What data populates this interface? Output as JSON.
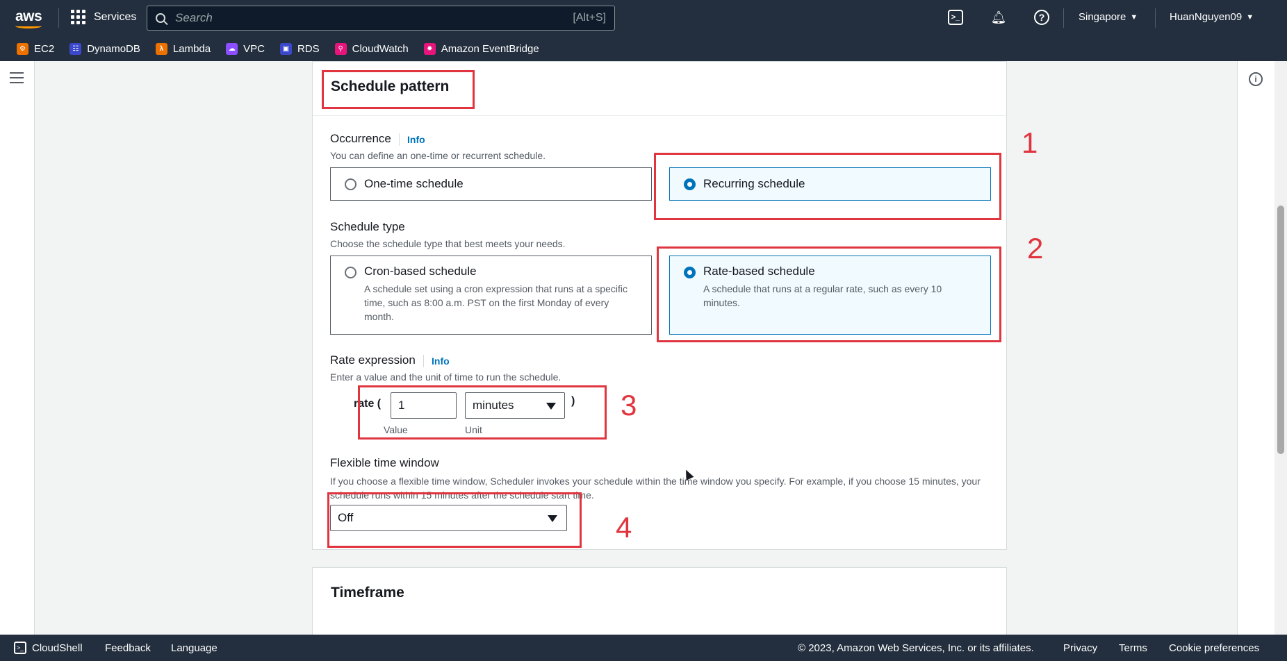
{
  "topnav": {
    "logo": "aws",
    "services_label": "Services",
    "search_placeholder": "Search",
    "search_shortcut": "[Alt+S]",
    "region": "Singapore",
    "user": "HuanNguyen09"
  },
  "favorites": [
    {
      "label": "EC2",
      "color": "#ed7100"
    },
    {
      "label": "DynamoDB",
      "color": "#3b48cc"
    },
    {
      "label": "Lambda",
      "color": "#ed7100"
    },
    {
      "label": "VPC",
      "color": "#8c4fff"
    },
    {
      "label": "RDS",
      "color": "#3b48cc"
    },
    {
      "label": "CloudWatch",
      "color": "#e7157b"
    },
    {
      "label": "Amazon EventBridge",
      "color": "#e7157b"
    }
  ],
  "schedule_pattern": {
    "title": "Schedule pattern",
    "occurrence": {
      "label": "Occurrence",
      "info": "Info",
      "description": "You can define an one-time or recurrent schedule.",
      "options": [
        {
          "label": "One-time schedule",
          "selected": false
        },
        {
          "label": "Recurring schedule",
          "selected": true
        }
      ]
    },
    "schedule_type": {
      "label": "Schedule type",
      "description": "Choose the schedule type that best meets your needs.",
      "options": [
        {
          "label": "Cron-based schedule",
          "description": "A schedule set using a cron expression that runs at a specific time, such as 8:00 a.m. PST on the first Monday of every month.",
          "selected": false
        },
        {
          "label": "Rate-based schedule",
          "description": "A schedule that runs at a regular rate, such as every 10 minutes.",
          "selected": true
        }
      ]
    },
    "rate_expression": {
      "label": "Rate expression",
      "info": "Info",
      "description": "Enter a value and the unit of time to run the schedule.",
      "prefix": "rate (",
      "suffix": ")",
      "value": "1",
      "value_label": "Value",
      "unit": "minutes",
      "unit_label": "Unit"
    },
    "flexible_window": {
      "label": "Flexible time window",
      "description": "If you choose a flexible time window, Scheduler invokes your schedule within the time window you specify. For example, if you choose 15 minutes, your schedule runs within 15 minutes after the schedule start time.",
      "value": "Off"
    }
  },
  "timeframe": {
    "title": "Timeframe"
  },
  "annotations": [
    "1",
    "2",
    "3",
    "4"
  ],
  "annotation_color": "#e0353f",
  "footer": {
    "cloudshell": "CloudShell",
    "feedback": "Feedback",
    "language": "Language",
    "copyright": "© 2023, Amazon Web Services, Inc. or its affiliates.",
    "privacy": "Privacy",
    "terms": "Terms",
    "cookies": "Cookie preferences"
  }
}
